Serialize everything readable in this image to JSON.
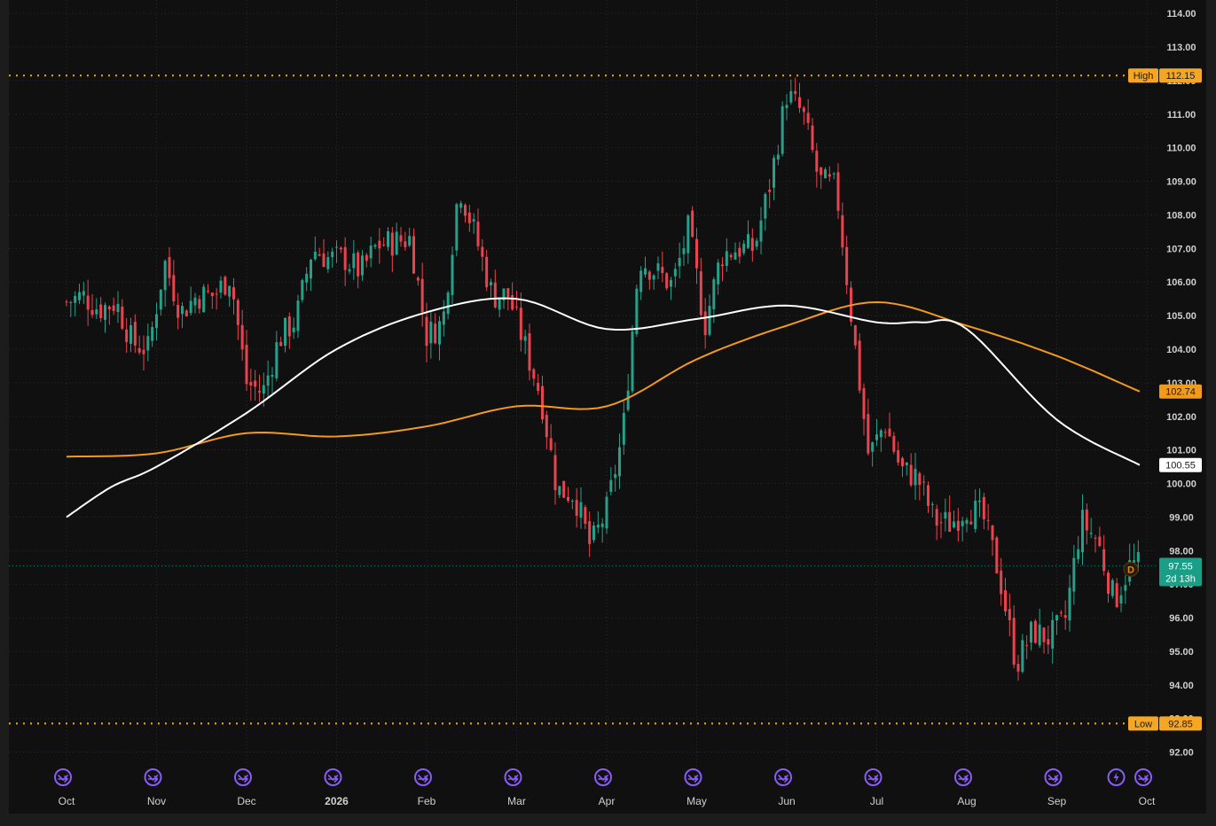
{
  "chart_data": {
    "type": "candlestick",
    "title": "",
    "y_ticks": [
      "114.00",
      "113.00",
      "112.00",
      "111.00",
      "110.00",
      "109.00",
      "108.00",
      "107.00",
      "106.00",
      "105.00",
      "104.00",
      "103.00",
      "102.00",
      "101.00",
      "100.00",
      "99.00",
      "98.00",
      "97.00",
      "96.00",
      "95.00",
      "94.00",
      "93.00",
      "92.00"
    ],
    "ylim": [
      91.7,
      114.4
    ],
    "x_labels": [
      {
        "label": "Oct",
        "month": 0,
        "bold": false
      },
      {
        "label": "Nov",
        "month": 1,
        "bold": false
      },
      {
        "label": "Dec",
        "month": 2,
        "bold": false
      },
      {
        "label": "2026",
        "month": 3,
        "bold": true
      },
      {
        "label": "Feb",
        "month": 4,
        "bold": false
      },
      {
        "label": "Mar",
        "month": 5,
        "bold": false
      },
      {
        "label": "Apr",
        "month": 6,
        "bold": false
      },
      {
        "label": "May",
        "month": 7,
        "bold": false
      },
      {
        "label": "Jun",
        "month": 8,
        "bold": false
      },
      {
        "label": "Jul",
        "month": 9,
        "bold": false
      },
      {
        "label": "Aug",
        "month": 10,
        "bold": false
      },
      {
        "label": "Sep",
        "month": 11,
        "bold": false
      },
      {
        "label": "Oct",
        "month": 12,
        "bold": false
      }
    ],
    "high": {
      "label": "High",
      "value": "112.15",
      "y": 112.15
    },
    "low": {
      "label": "Low",
      "value": "92.85",
      "y": 92.85
    },
    "last_price": {
      "value": "97.55",
      "countdown": "2d 13h",
      "y": 97.55
    },
    "ma_200": {
      "value": "102.74",
      "y": 102.74,
      "color": "#f29a1a"
    },
    "ma_100": {
      "value": "100.55",
      "y": 100.55,
      "color": "#ffffff"
    },
    "event_markers": [
      {
        "month": 0.0,
        "kind": "dividend"
      },
      {
        "month": 1.0,
        "kind": "dividend"
      },
      {
        "month": 2.0,
        "kind": "dividend"
      },
      {
        "month": 3.0,
        "kind": "dividend"
      },
      {
        "month": 4.0,
        "kind": "dividend"
      },
      {
        "month": 5.0,
        "kind": "dividend"
      },
      {
        "month": 6.0,
        "kind": "dividend"
      },
      {
        "month": 7.0,
        "kind": "dividend"
      },
      {
        "month": 8.0,
        "kind": "dividend"
      },
      {
        "month": 9.0,
        "kind": "dividend"
      },
      {
        "month": 10.0,
        "kind": "dividend"
      },
      {
        "month": 11.0,
        "kind": "dividend"
      },
      {
        "month": 11.7,
        "kind": "earnings"
      },
      {
        "month": 12.0,
        "kind": "dividend"
      }
    ],
    "d_marker": {
      "label": "D"
    },
    "colors": {
      "up": "#26a08a",
      "down": "#e8444f",
      "grid": "#2a2a2a",
      "axis_text": "#d0d0d0",
      "high_low": "#f5a623",
      "last": "#1a9e87",
      "event": "#8a5cf6"
    },
    "closes": [
      [
        0.0,
        105.4
      ],
      [
        0.18,
        105.6
      ],
      [
        0.36,
        105.2
      ],
      [
        0.55,
        105.4
      ],
      [
        0.73,
        104.2
      ],
      [
        0.91,
        104.0
      ],
      [
        1.09,
        106.6
      ],
      [
        1.27,
        105.1
      ],
      [
        1.45,
        105.6
      ],
      [
        1.64,
        105.6
      ],
      [
        1.82,
        106.2
      ],
      [
        2.0,
        103.0
      ],
      [
        2.18,
        102.7
      ],
      [
        2.36,
        104.3
      ],
      [
        2.55,
        104.9
      ],
      [
        2.73,
        107.0
      ],
      [
        2.91,
        106.7
      ],
      [
        3.09,
        106.7
      ],
      [
        3.27,
        106.3
      ],
      [
        3.45,
        107.1
      ],
      [
        3.64,
        107.2
      ],
      [
        3.82,
        107.3
      ],
      [
        4.0,
        104.4
      ],
      [
        4.18,
        104.8
      ],
      [
        4.36,
        108.9
      ],
      [
        4.55,
        107.3
      ],
      [
        4.73,
        105.6
      ],
      [
        4.91,
        105.6
      ],
      [
        5.09,
        104.1
      ],
      [
        5.27,
        102.6
      ],
      [
        5.45,
        99.8
      ],
      [
        5.64,
        99.7
      ],
      [
        5.82,
        98.1
      ],
      [
        6.0,
        99.2
      ],
      [
        6.18,
        101.5
      ],
      [
        6.36,
        106.7
      ],
      [
        6.55,
        106.3
      ],
      [
        6.73,
        105.9
      ],
      [
        6.91,
        107.6
      ],
      [
        7.09,
        104.7
      ],
      [
        7.27,
        106.8
      ],
      [
        7.45,
        107.0
      ],
      [
        7.64,
        107.0
      ],
      [
        7.82,
        109.0
      ],
      [
        8.0,
        111.6
      ],
      [
        8.18,
        111.0
      ],
      [
        8.36,
        109.0
      ],
      [
        8.55,
        108.8
      ],
      [
        8.73,
        104.7
      ],
      [
        8.91,
        100.8
      ],
      [
        9.09,
        101.8
      ],
      [
        9.27,
        100.4
      ],
      [
        9.45,
        100.2
      ],
      [
        9.64,
        98.9
      ],
      [
        9.82,
        98.8
      ],
      [
        10.0,
        99.3
      ],
      [
        10.18,
        99.0
      ],
      [
        10.36,
        97.3
      ],
      [
        10.55,
        94.6
      ],
      [
        10.73,
        95.6
      ],
      [
        10.91,
        95.4
      ],
      [
        11.09,
        95.9
      ],
      [
        11.27,
        98.9
      ],
      [
        11.45,
        98.3
      ],
      [
        11.64,
        96.5
      ],
      [
        11.82,
        97.6
      ],
      [
        11.91,
        97.55
      ]
    ],
    "ma_white": [
      [
        0,
        99.0
      ],
      [
        0.5,
        99.9
      ],
      [
        1.0,
        100.5
      ],
      [
        2.0,
        102.1
      ],
      [
        3.0,
        104.0
      ],
      [
        4.0,
        105.1
      ],
      [
        5.0,
        105.5
      ],
      [
        6.0,
        104.6
      ],
      [
        7.0,
        104.9
      ],
      [
        8.0,
        105.3
      ],
      [
        9.0,
        104.8
      ],
      [
        9.5,
        104.8
      ],
      [
        10.0,
        104.6
      ],
      [
        11.0,
        101.9
      ],
      [
        11.92,
        100.55
      ]
    ],
    "ma_orange": [
      [
        0,
        100.8
      ],
      [
        1.0,
        100.9
      ],
      [
        2.0,
        101.5
      ],
      [
        3.0,
        101.4
      ],
      [
        4.0,
        101.7
      ],
      [
        5.0,
        102.3
      ],
      [
        6.0,
        102.3
      ],
      [
        7.0,
        103.7
      ],
      [
        8.0,
        104.7
      ],
      [
        9.0,
        105.4
      ],
      [
        10.0,
        104.7
      ],
      [
        11.0,
        103.8
      ],
      [
        11.92,
        102.74
      ]
    ]
  }
}
